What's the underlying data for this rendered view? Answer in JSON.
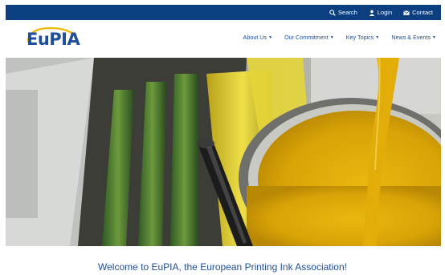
{
  "topbar": {
    "links": [
      {
        "label": "Search",
        "icon": "search-icon"
      },
      {
        "label": "Login",
        "icon": "user-icon"
      },
      {
        "label": "Contact",
        "icon": "envelope-icon"
      }
    ],
    "background": "#0b3f7f"
  },
  "logo": {
    "text": "EuPIA",
    "color": "#1f4e9a",
    "accent": "#f2b705"
  },
  "nav": {
    "items": [
      {
        "label": "About Us"
      },
      {
        "label": "Our Commitment"
      },
      {
        "label": "Key Topics"
      },
      {
        "label": "News & Events"
      }
    ]
  },
  "hero": {
    "image": "printing-press-yellow-ink-photo"
  },
  "welcome": {
    "text": "Welcome to EuPIA, the European Printing Ink Association!"
  }
}
